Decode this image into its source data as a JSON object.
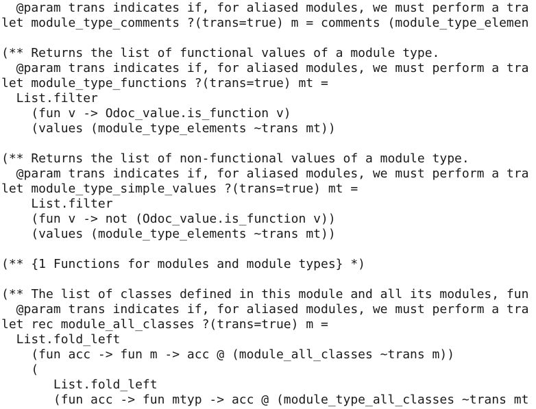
{
  "editor": {
    "lines": [
      "  @param trans indicates if, for aliased modules, we must perform a tra",
      "let module_type_comments ?(trans=true) m = comments (module_type_elemen",
      "",
      "(** Returns the list of functional values of a module type.",
      "  @param trans indicates if, for aliased modules, we must perform a tra",
      "let module_type_functions ?(trans=true) mt =",
      "  List.filter",
      "    (fun v -> Odoc_value.is_function v)",
      "    (values (module_type_elements ~trans mt))",
      "",
      "(** Returns the list of non-functional values of a module type.",
      "  @param trans indicates if, for aliased modules, we must perform a tra",
      "let module_type_simple_values ?(trans=true) mt =",
      "    List.filter",
      "    (fun v -> not (Odoc_value.is_function v))",
      "    (values (module_type_elements ~trans mt))",
      "",
      "(** {1 Functions for modules and module types} *)",
      "",
      "(** The list of classes defined in this module and all its modules, fun",
      "  @param trans indicates if, for aliased modules, we must perform a tra",
      "let rec module_all_classes ?(trans=true) m =",
      "  List.fold_left",
      "    (fun acc -> fun m -> acc @ (module_all_classes ~trans m))",
      "    (",
      "       List.fold_left",
      "       (fun acc -> fun mtyp -> acc @ (module_type_all_classes ~trans mt"
    ]
  }
}
